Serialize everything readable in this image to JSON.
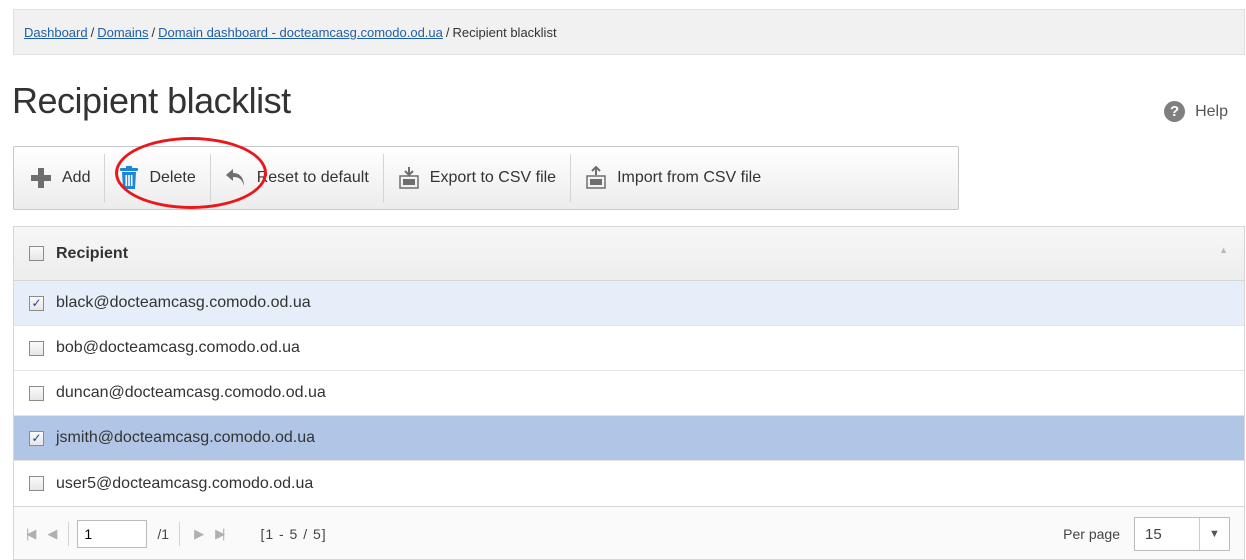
{
  "breadcrumb": {
    "items": [
      "Dashboard",
      "Domains",
      "Domain dashboard - docteamcasg.comodo.od.ua"
    ],
    "current": "Recipient blacklist",
    "separator": "/"
  },
  "page": {
    "title": "Recipient blacklist",
    "help_label": "Help",
    "help_icon": "?"
  },
  "toolbar": {
    "add_label": "Add",
    "delete_label": "Delete",
    "reset_label": "Reset to default",
    "export_label": "Export to CSV file",
    "import_label": "Import from CSV file"
  },
  "grid": {
    "column_header": "Recipient",
    "rows": [
      {
        "email": "black@docteamcasg.comodo.od.ua",
        "checked": true
      },
      {
        "email": "bob@docteamcasg.comodo.od.ua",
        "checked": false
      },
      {
        "email": "duncan@docteamcasg.comodo.od.ua",
        "checked": false
      },
      {
        "email": "jsmith@docteamcasg.comodo.od.ua",
        "checked": true
      },
      {
        "email": "user5@docteamcasg.comodo.od.ua",
        "checked": false
      }
    ]
  },
  "pager": {
    "current_page": "1",
    "total_pages": "/1",
    "range": "[1 - 5 / 5]",
    "per_page_label": "Per page",
    "per_page_value": "15"
  },
  "colors": {
    "link": "#1f5fa8",
    "highlight_ring": "#e8181c",
    "delete_icon": "#1c86d8",
    "row_selected_light": "#e6eef9",
    "row_selected_dark": "#b1c6e6"
  }
}
